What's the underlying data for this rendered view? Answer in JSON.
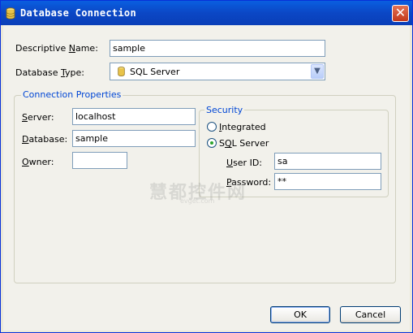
{
  "window": {
    "title": "Database Connection",
    "close_glyph": "✕"
  },
  "form": {
    "descriptive_name": {
      "label_prefix": "Descriptive ",
      "label_mnemonic": "N",
      "label_suffix": "ame:",
      "value": "sample"
    },
    "database_type": {
      "label_prefix": "Database ",
      "label_mnemonic": "T",
      "label_suffix": "ype:",
      "value": "SQL Server",
      "icon": "database-icon"
    }
  },
  "connection_properties": {
    "title": "Connection Properties",
    "server": {
      "label_mnemonic": "S",
      "label_suffix": "erver:",
      "value": "localhost"
    },
    "database": {
      "label_mnemonic": "D",
      "label_suffix": "atabase:",
      "value": "sample"
    },
    "owner": {
      "label_mnemonic": "O",
      "label_suffix": "wner:",
      "value": ""
    }
  },
  "security": {
    "title": "Security",
    "integrated": {
      "label_mnemonic": "I",
      "label_suffix": "ntegrated",
      "checked": false
    },
    "sql_server": {
      "label_prefix": "S",
      "label_mnemonic": "Q",
      "label_suffix": "L Server",
      "checked": true
    },
    "user_id": {
      "label_mnemonic": "U",
      "label_suffix": "ser ID:",
      "value": "sa"
    },
    "password": {
      "label_mnemonic": "P",
      "label_suffix": "assword:",
      "value": "**"
    }
  },
  "buttons": {
    "ok": "OK",
    "cancel": "Cancel"
  },
  "watermark": {
    "text": "慧都控件网",
    "sub": "evget.com"
  }
}
